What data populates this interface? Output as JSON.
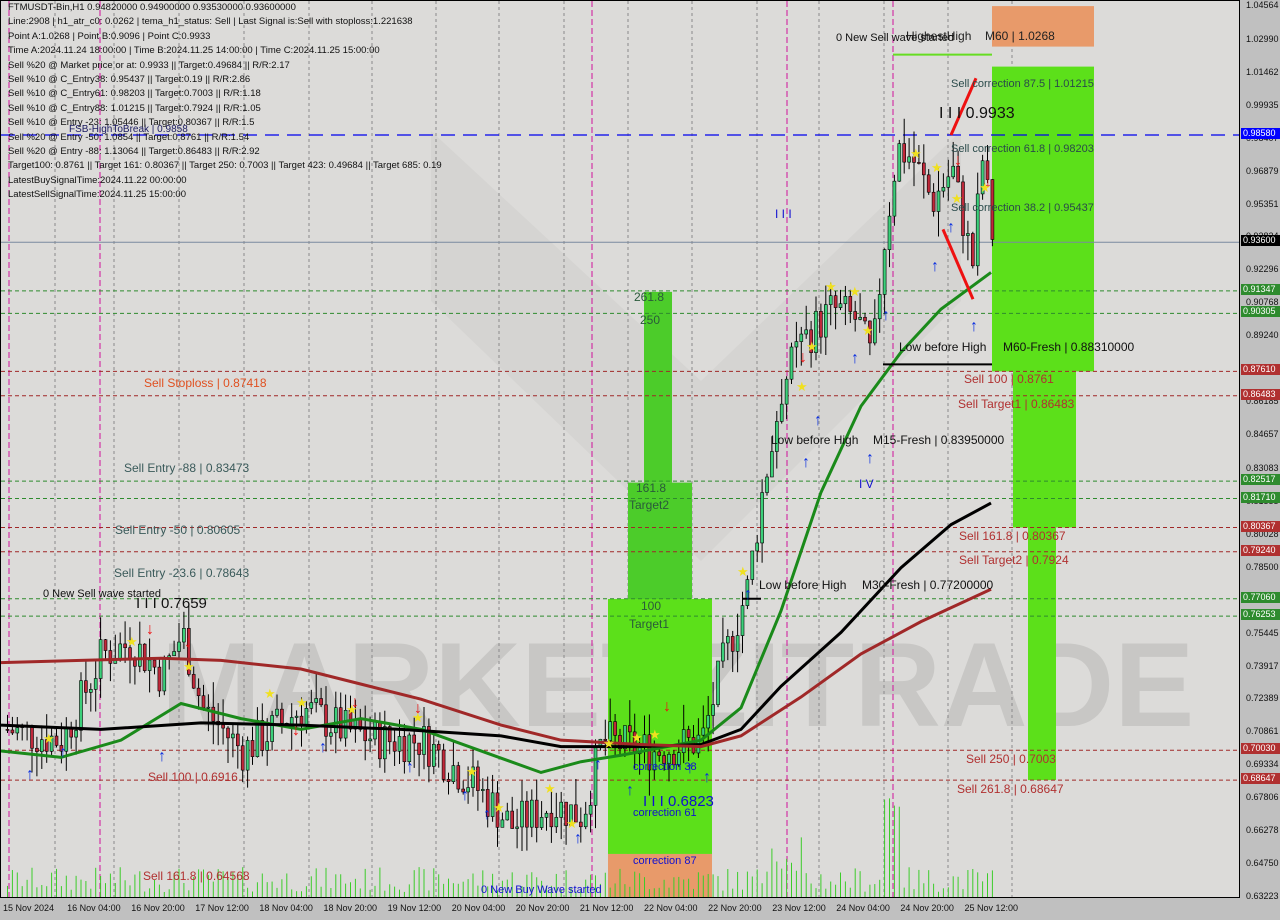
{
  "header": {
    "symbol_line": "FTMUSDT-Bin,H1  0.94820000 0.94900000 0.93530000 0.93600000",
    "info_lines": [
      "Line:2908 | h1_atr_c0: 0.0262 | tema_h1_status: Sell | Last Signal is:Sell with stoploss:1.221638",
      "Point A:1.0268 | Point B:0.9096 | Point C:0.9933",
      "Time A:2024.11.24 18:00:00 | Time B:2024.11.25 14:00:00 | Time C:2024.11.25 15:00:00",
      "Sell %20 @ Market price or at: 0.9933 || Target:0.49684 || R/R:2.17",
      "Sell %10 @ C_Entry38: 0.95437 || Target:0.19 || R/R:2.86",
      "Sell %10 @ C_Entry61: 0.98203 || Target:0.7003 || R/R:1.18",
      "Sell %10 @ C_Entry88: 1.01215 || Target:0.7924 || R/R:1.05",
      "Sell %10 @ Entry -23: 1.05446 || Target:0.80367 || R/R:1.5",
      "Sell %20 @ Entry -50: 1.0854 || Target:0.8761 || R/R:1.54",
      "Sell %20 @ Entry -88: 1.13064 || Target:0.86483 || R/R:2.92",
      "Target100: 0.8761 || Target 161: 0.80367 || Target 250: 0.7003 || Target 423: 0.49684 || Target 685: 0.19",
      "LatestBuySignalTime:2024.11.22 00:00:00",
      "LatestSellSignalTime:2024.11.25 15:00:00"
    ],
    "fsb_label": "FSB-HighToBreak | 0.9858"
  },
  "chart_data": {
    "type": "candlestick",
    "title": "FTMUSDT-Bin,H1",
    "ohlc_last": {
      "open": 0.9482,
      "high": 0.949,
      "low": 0.9353,
      "close": 0.936
    },
    "ylim": [
      0.63223,
      1.04564
    ],
    "y_ticks": [
      "1.04564",
      "1.02990",
      "1.01462",
      "0.99935",
      "0.98407",
      "0.96879",
      "0.95351",
      "0.93824",
      "0.92296",
      "0.90768",
      "0.89240",
      "0.87713",
      "0.86185",
      "0.84657",
      "0.83083",
      "0.81555",
      "0.80028",
      "0.78500",
      "0.76972",
      "0.75445",
      "0.73917",
      "0.72389",
      "0.70861",
      "0.69334",
      "0.67806",
      "0.66278",
      "0.64750",
      "0.63223"
    ],
    "x_ticks": [
      "15 Nov 2024",
      "16 Nov 04:00",
      "16 Nov 20:00",
      "17 Nov 12:00",
      "18 Nov 04:00",
      "18 Nov 20:00",
      "19 Nov 12:00",
      "20 Nov 04:00",
      "20 Nov 20:00",
      "21 Nov 12:00",
      "22 Nov 04:00",
      "22 Nov 20:00",
      "23 Nov 12:00",
      "24 Nov 04:00",
      "24 Nov 20:00",
      "25 Nov 12:00"
    ],
    "price_tags": [
      {
        "value": "0.98580",
        "color": "#0000ff"
      },
      {
        "value": "0.93600",
        "color": "#000000"
      },
      {
        "value": "0.91347",
        "color": "#2e8b2e"
      },
      {
        "value": "0.90305",
        "color": "#2e8b2e"
      },
      {
        "value": "0.87610",
        "color": "#b03030"
      },
      {
        "value": "0.86483",
        "color": "#b03030"
      },
      {
        "value": "0.82517",
        "color": "#2e8b2e"
      },
      {
        "value": "0.81710",
        "color": "#2e8b2e"
      },
      {
        "value": "0.80367",
        "color": "#b03030"
      },
      {
        "value": "0.79240",
        "color": "#b03030"
      },
      {
        "value": "0.77060",
        "color": "#2e8b2e"
      },
      {
        "value": "0.76253",
        "color": "#2e8b2e"
      },
      {
        "value": "0.70030",
        "color": "#b03030"
      },
      {
        "value": "0.68647",
        "color": "#b03030"
      }
    ],
    "levels": [
      {
        "label": "Sell Stoploss | 0.87418",
        "value": 0.87418,
        "color": "#e05020"
      },
      {
        "label": "Sell Entry -88 | 0.83473",
        "value": 0.83473,
        "color": "#3a5a5a"
      },
      {
        "label": "Sell Entry -50 | 0.80605",
        "value": 0.80605,
        "color": "#3a5a5a"
      },
      {
        "label": "Sell Entry -23.6 | 0.78643",
        "value": 0.78643,
        "color": "#3a5a5a"
      },
      {
        "label": "Sell 100 | 0.8761",
        "value": 0.8761,
        "color": "#b03030"
      },
      {
        "label": "Sell Target1 | 0.86483",
        "value": 0.86483,
        "color": "#b03030"
      },
      {
        "label": "Sell 161.8 | 0.80367",
        "value": 0.80367,
        "color": "#b03030"
      },
      {
        "label": "Sell Target2 | 0.7924",
        "value": 0.7924,
        "color": "#b03030"
      },
      {
        "label": "Sell 250 | 0.7003",
        "value": 0.7003,
        "color": "#b03030"
      },
      {
        "label": "Sell 261.8 | 0.68647",
        "value": 0.68647,
        "color": "#b03030"
      },
      {
        "label": "Sell 100 | 0.6916",
        "value": 0.6916,
        "color": "#b03030"
      },
      {
        "label": "Sell 161.8 | 0.64568",
        "value": 0.64568,
        "color": "#b03030"
      }
    ],
    "annotations": {
      "highest_high": "HighestHigh",
      "m60_high": "M60 | 1.0268",
      "new_sell_wave_top": "0 New Sell wave started",
      "new_sell_wave_left": "0 New Sell wave started",
      "new_buy_wave": "0 New Buy Wave started",
      "sell_corr_875": "Sell correction 87.5 | 1.01215",
      "sell_corr_618": "Sell correction 61.8 | 0.98203",
      "sell_corr_382": "Sell correction 38.2 | 0.95437",
      "point_c": "I I I 0.9933",
      "wave_i_top": "I I I",
      "low_before_high_m60": "Low before High",
      "m60_fresh": "M60-Fresh | 0.88310000",
      "low_before_high_m15": "Low before High",
      "m15_fresh": "M15-Fresh | 0.83950000",
      "wave_iv": "I V",
      "low_before_high_m30": "Low before High",
      "m30_fresh": "M30-Fresh | 0.77200000",
      "left_wave": "I I I 0.7659",
      "buy_wave_low": "I I I 0.6823",
      "corr_38": "correction 38",
      "corr_61": "correction 61",
      "corr_87": "correction 87",
      "t_2618": "261.8",
      "t_250": "250",
      "t_1618": "161.8",
      "t_target2": "Target2",
      "t_100": "100",
      "t_target1": "Target1"
    },
    "moving_averages": [
      {
        "name": "green_ma",
        "color": "#1a8a1a"
      },
      {
        "name": "black_ma",
        "color": "#000000"
      },
      {
        "name": "brown_ma",
        "color": "#a02828"
      }
    ]
  },
  "watermark": "MARKETZITRADE"
}
